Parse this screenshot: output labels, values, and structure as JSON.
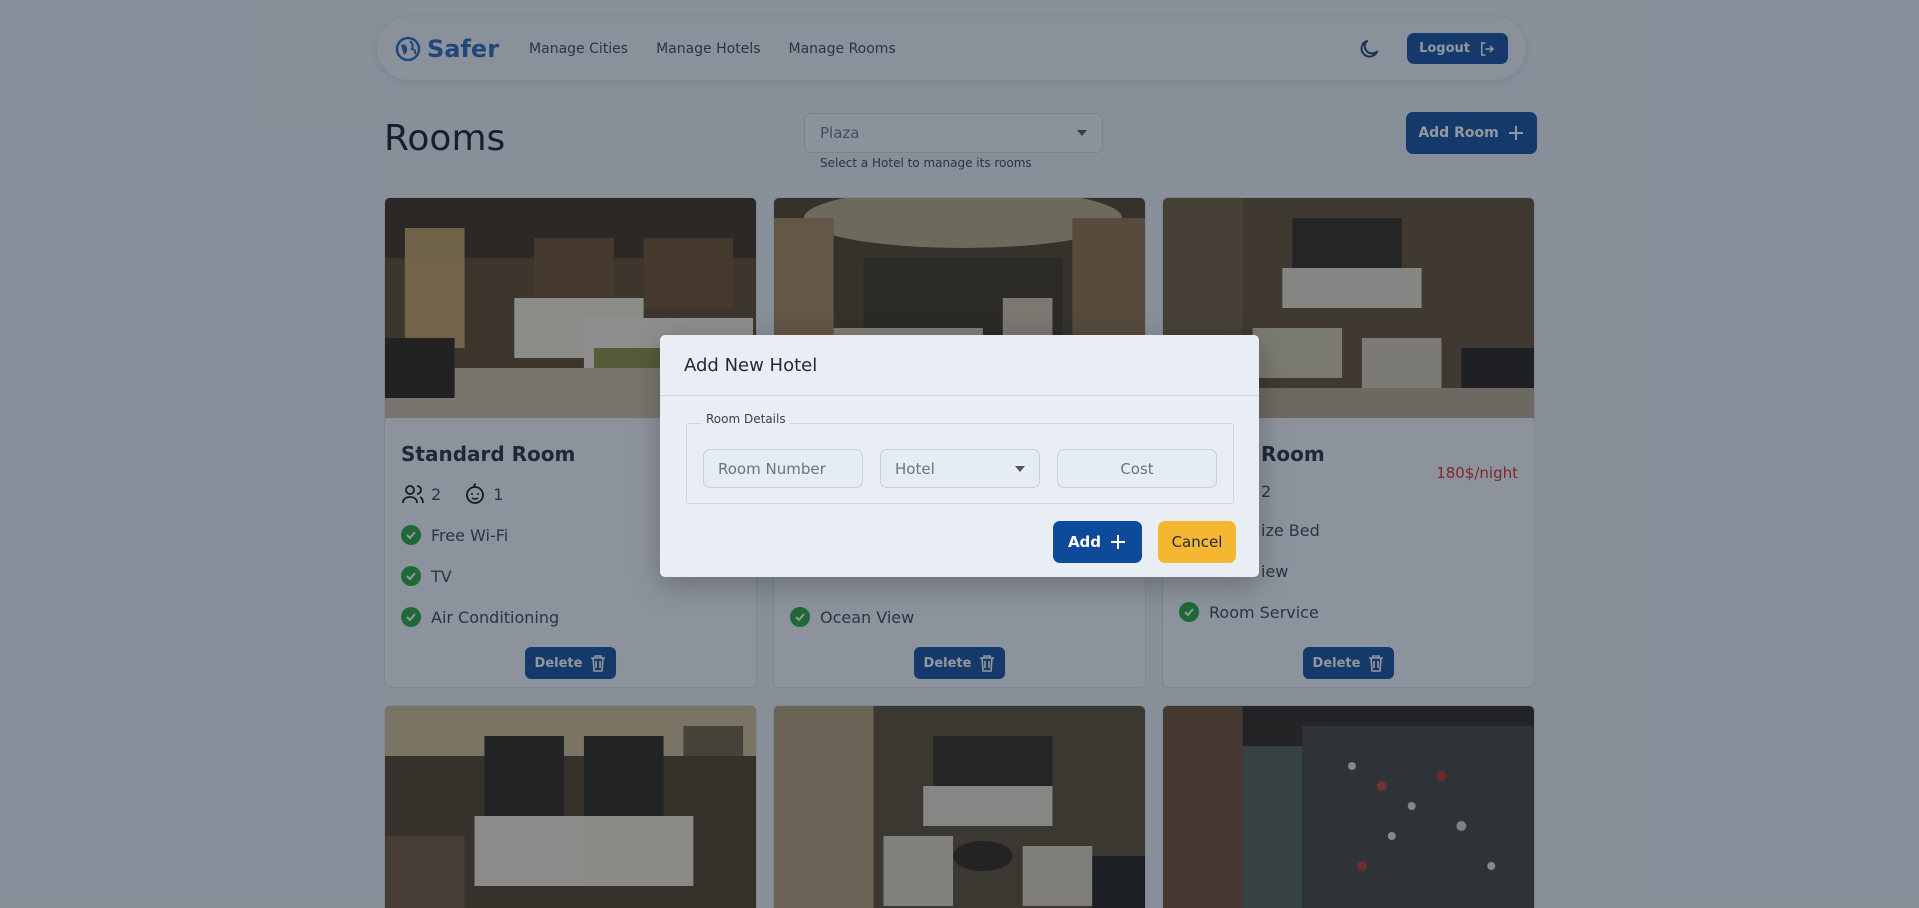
{
  "nav": {
    "brand": "Safer",
    "links": [
      "Manage Cities",
      "Manage Hotels",
      "Manage Rooms"
    ],
    "logout_label": "Logout"
  },
  "page": {
    "title": "Rooms",
    "hotel_select_value": "Plaza",
    "hotel_select_hint": "Select a Hotel to manage its rooms",
    "add_room_label": "Add Room"
  },
  "cards": [
    {
      "name": "Standard Room",
      "price": "",
      "adults": "2",
      "children": "1",
      "amenities": [
        "Free Wi-Fi",
        "TV",
        "Air Conditioning"
      ],
      "delete_label": "Delete"
    },
    {
      "name": "",
      "price": "",
      "adults": "",
      "children": "",
      "amenities": [
        "Ocean View"
      ],
      "delete_label": "Delete"
    },
    {
      "name": "Room",
      "price": "180$/night",
      "adults": "2",
      "children": "",
      "amenities": [
        "ize Bed",
        "iew",
        "Room Service"
      ],
      "delete_label": "Delete"
    }
  ],
  "modal": {
    "title": "Add New Hotel",
    "legend": "Room Details",
    "room_number_placeholder": "Room Number",
    "hotel_placeholder": "Hotel",
    "cost_placeholder": "Cost",
    "add_label": "Add",
    "cancel_label": "Cancel"
  },
  "colors": {
    "primary": "#0d4a9a",
    "accent_yellow": "#f5b731",
    "price_red": "#dc2626",
    "check_green": "#22a33b",
    "brand_blue": "#2563b8"
  }
}
